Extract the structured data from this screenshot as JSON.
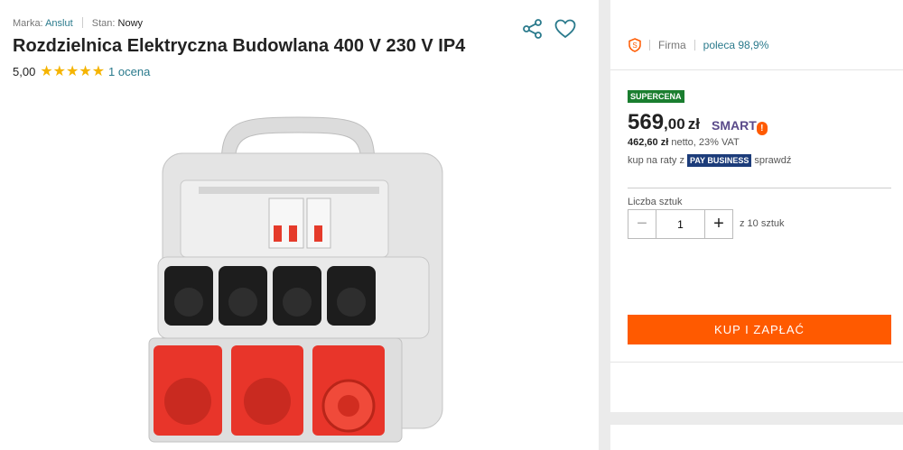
{
  "product": {
    "brand_label": "Marka:",
    "brand": "Anslut",
    "condition_label": "Stan:",
    "condition": "Nowy",
    "title": "Rozdzielnica Elektryczna Budowlana 400 V 230 V IP4",
    "rating_value": "5,00",
    "stars": "★★★★★",
    "rating_count": "1 ocena"
  },
  "seller": {
    "type": "Firma",
    "recommend": "poleca 98,9%"
  },
  "offer": {
    "badge": "SUPERCENA",
    "price_int": "569",
    "price_dec": ",00",
    "currency": "zł",
    "smart": "SMART",
    "netto_value": "462,60 zł",
    "netto_text": "netto, 23% VAT",
    "raty_text": "kup na raty z",
    "raty_brand": "PAY BUSINESS",
    "raty_check": "sprawdź",
    "qty_label": "Liczba sztuk",
    "qty_value": "1",
    "qty_of": "z 10 sztuk",
    "buy_label": "KUP I ZAPŁAĆ"
  },
  "icons": [
    "share-icon",
    "heart-icon",
    "seller-badge-icon",
    "minus-icon",
    "plus-icon"
  ],
  "colors": {
    "accent": "#ff5a00",
    "link": "#2a7a8c",
    "badge": "#1a7e2f",
    "stars": "#f5b400"
  }
}
